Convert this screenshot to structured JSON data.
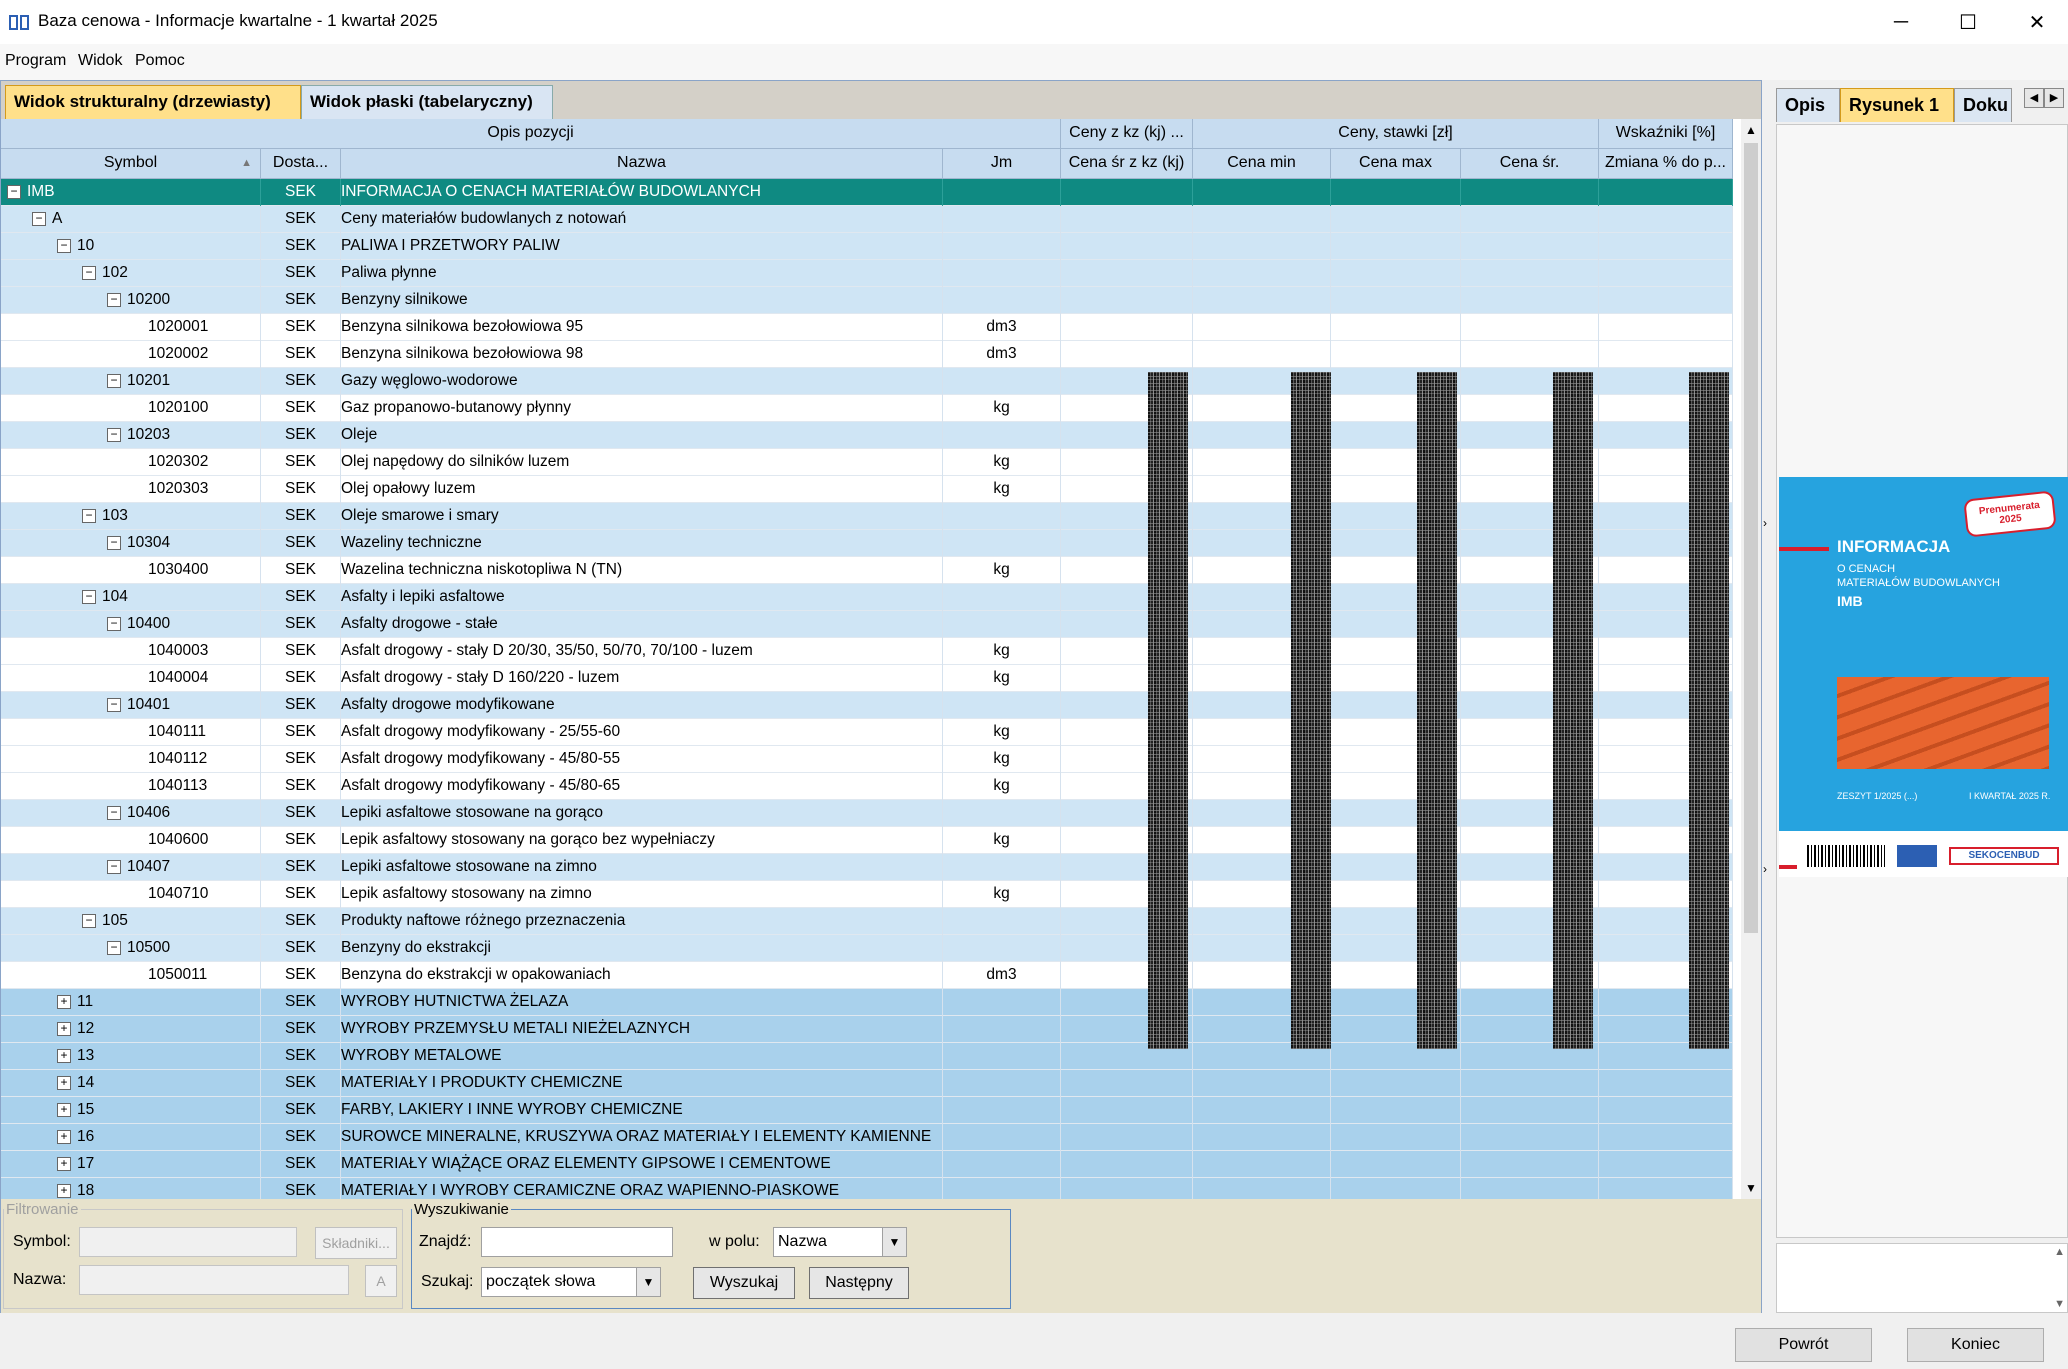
{
  "window": {
    "title": "Baza cenowa - Informacje kwartalne - 1 kwartał 2025",
    "minimize": "─",
    "maximize": "☐",
    "close": "✕"
  },
  "menu": [
    "Program",
    "Widok",
    "Pomoc"
  ],
  "view_tabs": [
    "Widok strukturalny (drzewiasty)",
    "Widok płaski (tabelaryczny)"
  ],
  "grid": {
    "group_headers": {
      "opis": "Opis pozycji",
      "ceny_kz": "Ceny z kz (kj) ...",
      "ceny_stawki": "Ceny, stawki [zł]",
      "wskazniki": "Wskaźniki [%]"
    },
    "columns": {
      "symbol": "Symbol",
      "sort_arrow": "▲",
      "dostawca": "Dosta...",
      "nazwa": "Nazwa",
      "jm": "Jm",
      "cena_sr_kz": "Cena śr z kz (kj)",
      "cena_min": "Cena min",
      "cena_max": "Cena max",
      "cena_sr": "Cena śr.",
      "zmiana": "Zmiana % do p..."
    },
    "rows": [
      {
        "level": 0,
        "toggle": "−",
        "symbol": "IMB",
        "dost": "SEK",
        "nazwa": "INFORMACJA O CENACH MATERIAŁÓW BUDOWLANYCH",
        "jm": "",
        "kind": "top"
      },
      {
        "level": 1,
        "toggle": "−",
        "symbol": "A",
        "dost": "SEK",
        "nazwa": "Ceny materiałów budowlanych z notowań",
        "jm": "",
        "kind": "lvl"
      },
      {
        "level": 2,
        "toggle": "−",
        "symbol": "10",
        "dost": "SEK",
        "nazwa": "PALIWA I PRZETWORY PALIW",
        "jm": "",
        "kind": "lvl"
      },
      {
        "level": 3,
        "toggle": "−",
        "symbol": "102",
        "dost": "SEK",
        "nazwa": "Paliwa płynne",
        "jm": "",
        "kind": "lvl"
      },
      {
        "level": 4,
        "toggle": "−",
        "symbol": "10200",
        "dost": "SEK",
        "nazwa": "Benzyny silnikowe",
        "jm": "",
        "kind": "lvl"
      },
      {
        "level": 5,
        "toggle": "",
        "symbol": "1020001",
        "dost": "SEK",
        "nazwa": "Benzyna silnikowa bezołowiowa 95",
        "jm": "dm3",
        "kind": "leaf"
      },
      {
        "level": 5,
        "toggle": "",
        "symbol": "1020002",
        "dost": "SEK",
        "nazwa": "Benzyna silnikowa bezołowiowa 98",
        "jm": "dm3",
        "kind": "leaf"
      },
      {
        "level": 4,
        "toggle": "−",
        "symbol": "10201",
        "dost": "SEK",
        "nazwa": "Gazy węglowo-wodorowe",
        "jm": "",
        "kind": "lvl"
      },
      {
        "level": 5,
        "toggle": "",
        "symbol": "1020100",
        "dost": "SEK",
        "nazwa": "Gaz propanowo-butanowy płynny",
        "jm": "kg",
        "kind": "leaf"
      },
      {
        "level": 4,
        "toggle": "−",
        "symbol": "10203",
        "dost": "SEK",
        "nazwa": "Oleje",
        "jm": "",
        "kind": "lvl"
      },
      {
        "level": 5,
        "toggle": "",
        "symbol": "1020302",
        "dost": "SEK",
        "nazwa": "Olej napędowy do silników luzem",
        "jm": "kg",
        "kind": "leaf"
      },
      {
        "level": 5,
        "toggle": "",
        "symbol": "1020303",
        "dost": "SEK",
        "nazwa": "Olej opałowy luzem",
        "jm": "kg",
        "kind": "leaf"
      },
      {
        "level": 3,
        "toggle": "−",
        "symbol": "103",
        "dost": "SEK",
        "nazwa": "Oleje smarowe i smary",
        "jm": "",
        "kind": "lvl"
      },
      {
        "level": 4,
        "toggle": "−",
        "symbol": "10304",
        "dost": "SEK",
        "nazwa": "Wazeliny techniczne",
        "jm": "",
        "kind": "lvl"
      },
      {
        "level": 5,
        "toggle": "",
        "symbol": "1030400",
        "dost": "SEK",
        "nazwa": "Wazelina techniczna niskotopliwa N (TN)",
        "jm": "kg",
        "kind": "leaf"
      },
      {
        "level": 3,
        "toggle": "−",
        "symbol": "104",
        "dost": "SEK",
        "nazwa": "Asfalty i lepiki asfaltowe",
        "jm": "",
        "kind": "lvl"
      },
      {
        "level": 4,
        "toggle": "−",
        "symbol": "10400",
        "dost": "SEK",
        "nazwa": "Asfalty drogowe - stałe",
        "jm": "",
        "kind": "lvl"
      },
      {
        "level": 5,
        "toggle": "",
        "symbol": "1040003",
        "dost": "SEK",
        "nazwa": "Asfalt drogowy - stały D 20/30, 35/50, 50/70, 70/100 - luzem",
        "jm": "kg",
        "kind": "leaf"
      },
      {
        "level": 5,
        "toggle": "",
        "symbol": "1040004",
        "dost": "SEK",
        "nazwa": "Asfalt drogowy - stały D 160/220 - luzem",
        "jm": "kg",
        "kind": "leaf"
      },
      {
        "level": 4,
        "toggle": "−",
        "symbol": "10401",
        "dost": "SEK",
        "nazwa": "Asfalty drogowe modyfikowane",
        "jm": "",
        "kind": "lvl"
      },
      {
        "level": 5,
        "toggle": "",
        "symbol": "1040111",
        "dost": "SEK",
        "nazwa": "Asfalt drogowy modyfikowany - 25/55-60",
        "jm": "kg",
        "kind": "leaf"
      },
      {
        "level": 5,
        "toggle": "",
        "symbol": "1040112",
        "dost": "SEK",
        "nazwa": "Asfalt drogowy modyfikowany - 45/80-55",
        "jm": "kg",
        "kind": "leaf"
      },
      {
        "level": 5,
        "toggle": "",
        "symbol": "1040113",
        "dost": "SEK",
        "nazwa": "Asfalt drogowy modyfikowany - 45/80-65",
        "jm": "kg",
        "kind": "leaf"
      },
      {
        "level": 4,
        "toggle": "−",
        "symbol": "10406",
        "dost": "SEK",
        "nazwa": "Lepiki asfaltowe stosowane na gorąco",
        "jm": "",
        "kind": "lvl"
      },
      {
        "level": 5,
        "toggle": "",
        "symbol": "1040600",
        "dost": "SEK",
        "nazwa": "Lepik asfaltowy stosowany na gorąco bez wypełniaczy",
        "jm": "kg",
        "kind": "leaf"
      },
      {
        "level": 4,
        "toggle": "−",
        "symbol": "10407",
        "dost": "SEK",
        "nazwa": "Lepiki asfaltowe stosowane na zimno",
        "jm": "",
        "kind": "lvl"
      },
      {
        "level": 5,
        "toggle": "",
        "symbol": "1040710",
        "dost": "SEK",
        "nazwa": "Lepik asfaltowy stosowany na zimno",
        "jm": "kg",
        "kind": "leaf"
      },
      {
        "level": 3,
        "toggle": "−",
        "symbol": "105",
        "dost": "SEK",
        "nazwa": "Produkty naftowe różnego przeznaczenia",
        "jm": "",
        "kind": "lvl"
      },
      {
        "level": 4,
        "toggle": "−",
        "symbol": "10500",
        "dost": "SEK",
        "nazwa": "Benzyny do ekstrakcji",
        "jm": "",
        "kind": "lvl"
      },
      {
        "level": 5,
        "toggle": "",
        "symbol": "1050011",
        "dost": "SEK",
        "nazwa": "Benzyna do ekstrakcji w opakowaniach",
        "jm": "dm3",
        "kind": "leaf"
      },
      {
        "level": 2,
        "toggle": "+",
        "symbol": "11",
        "dost": "SEK",
        "nazwa": "WYROBY HUTNICTWA ŻELAZA",
        "jm": "",
        "kind": "collapsed"
      },
      {
        "level": 2,
        "toggle": "+",
        "symbol": "12",
        "dost": "SEK",
        "nazwa": "WYROBY PRZEMYSŁU METALI NIEŻELAZNYCH",
        "jm": "",
        "kind": "collapsed"
      },
      {
        "level": 2,
        "toggle": "+",
        "symbol": "13",
        "dost": "SEK",
        "nazwa": "WYROBY METALOWE",
        "jm": "",
        "kind": "collapsed"
      },
      {
        "level": 2,
        "toggle": "+",
        "symbol": "14",
        "dost": "SEK",
        "nazwa": "MATERIAŁY I PRODUKTY CHEMICZNE",
        "jm": "",
        "kind": "collapsed"
      },
      {
        "level": 2,
        "toggle": "+",
        "symbol": "15",
        "dost": "SEK",
        "nazwa": "FARBY, LAKIERY I INNE WYROBY CHEMICZNE",
        "jm": "",
        "kind": "collapsed"
      },
      {
        "level": 2,
        "toggle": "+",
        "symbol": "16",
        "dost": "SEK",
        "nazwa": "SUROWCE MINERALNE, KRUSZYWA ORAZ MATERIAŁY I ELEMENTY KAMIENNE",
        "jm": "",
        "kind": "collapsed"
      },
      {
        "level": 2,
        "toggle": "+",
        "symbol": "17",
        "dost": "SEK",
        "nazwa": "MATERIAŁY WIĄŻĄCE ORAZ ELEMENTY GIPSOWE I CEMENTOWE",
        "jm": "",
        "kind": "collapsed"
      },
      {
        "level": 2,
        "toggle": "+",
        "symbol": "18",
        "dost": "SEK",
        "nazwa": "MATERIAŁY I WYROBY CERAMICZNE ORAZ WAPIENNO-PIASKOWE",
        "jm": "",
        "kind": "collapsed"
      }
    ]
  },
  "filters": {
    "legend": "Filtrowanie",
    "symbol_label": "Symbol:",
    "skladniki_button": "Składniki...",
    "nazwa_label": "Nazwa:",
    "nazwa_button": "A"
  },
  "search": {
    "legend": "Wyszukiwanie",
    "znajdz_label": "Znajdź:",
    "w_polu_label": "w polu:",
    "w_polu_value": "Nazwa",
    "szukaj_label": "Szukaj:",
    "szukaj_value": "początek słowa",
    "wyszukaj_button": "Wyszukaj",
    "nastepny_button": "Następny"
  },
  "right_tabs": [
    "Opis",
    "Rysunek 1",
    "Doku"
  ],
  "cover": {
    "badge": "Prenumerata 2025",
    "title": "INFORMACJA",
    "subtitle1": "O CENACH",
    "subtitle2": "MATERIAŁÓW BUDOWLANYCH",
    "code": "IMB",
    "issue": "ZESZYT 1/2025 (...)",
    "quarter": "I KWARTAŁ 2025 R.",
    "brand": "SEKOCENBUD"
  },
  "bottom_buttons": {
    "powrot": "Powrót",
    "koniec": "Koniec"
  },
  "colors": {
    "accent": "#ffe08a",
    "selected_row": "#0f8a82",
    "tree_row": "#cfe5f5",
    "collapsed_row": "#a9d1ec"
  }
}
